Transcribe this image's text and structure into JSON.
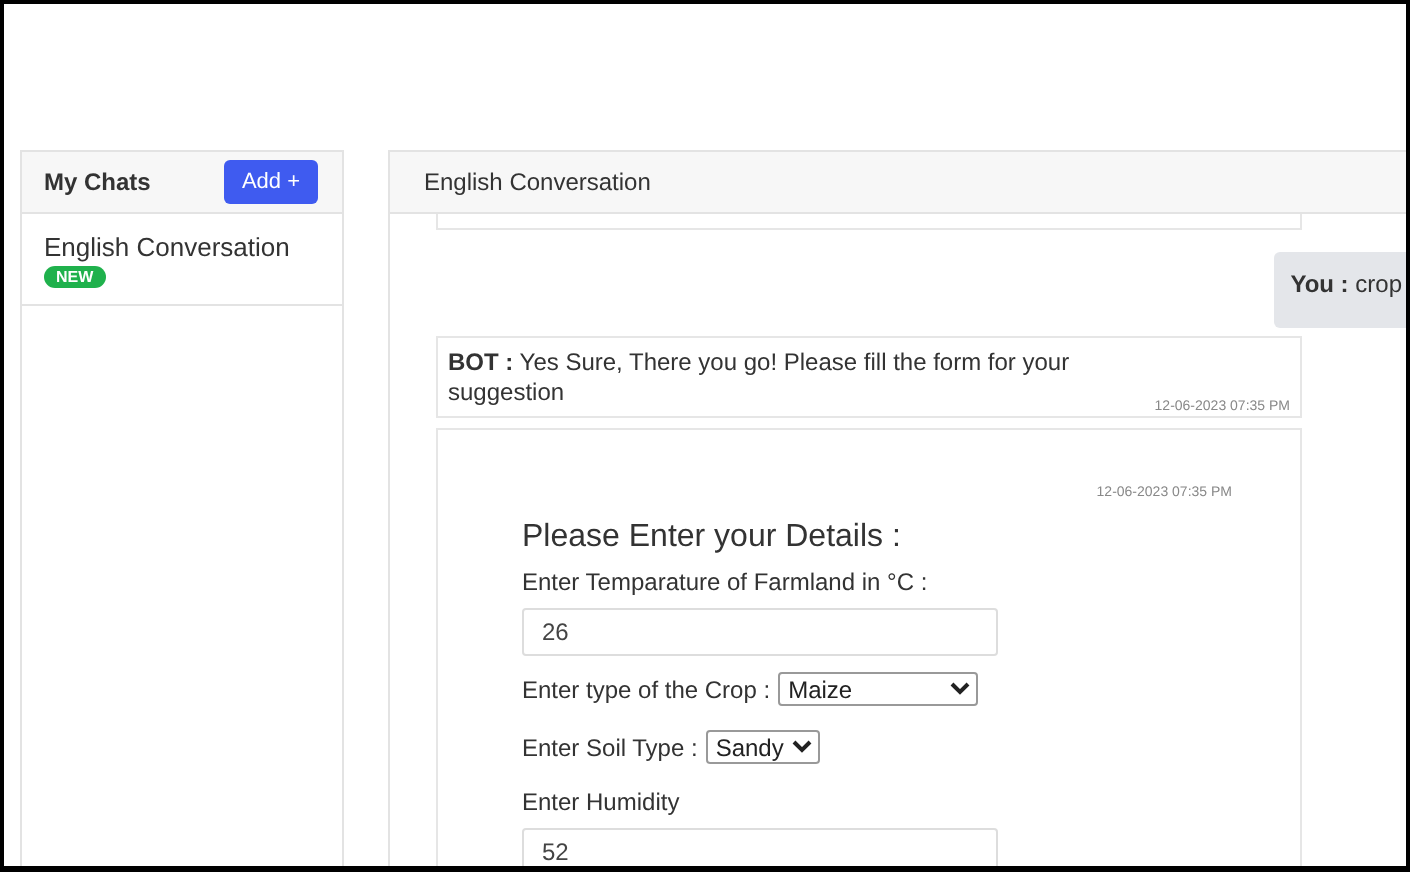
{
  "sidebar": {
    "title": "My Chats",
    "add_button": "Add +",
    "chats": [
      {
        "name": "English Conversation",
        "badge": "NEW"
      }
    ]
  },
  "chat": {
    "title": "English Conversation",
    "messages": [
      {
        "kind": "user",
        "sender": "You :",
        "text": "crop"
      },
      {
        "kind": "bot",
        "sender": "BOT :",
        "text": "Yes Sure, There you go! Please fill the form for your suggestion",
        "time": "12-06-2023 07:35 PM"
      }
    ],
    "form": {
      "time": "12-06-2023 07:35 PM",
      "title": "Please Enter your Details :",
      "fields": [
        {
          "kind": "input",
          "label": "Enter Temparature of Farmland in °C :",
          "value": "26"
        },
        {
          "kind": "select",
          "label": "Enter type of the Crop :",
          "value": "Maize"
        },
        {
          "kind": "select",
          "label": "Enter Soil Type :",
          "value": "Sandy"
        },
        {
          "kind": "input",
          "label": "Enter Humidity",
          "value": "52"
        }
      ]
    }
  }
}
